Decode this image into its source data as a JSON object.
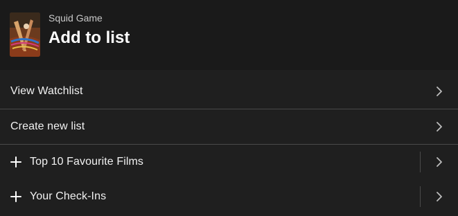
{
  "header": {
    "subtitle": "Squid Game",
    "title": "Add to list",
    "poster_icon": "poster-thumbnail"
  },
  "rows": [
    {
      "label": "View Watchlist",
      "icon": "chevron-right-icon"
    },
    {
      "label": "Create new list",
      "icon": "chevron-right-icon"
    },
    {
      "label": "Top 10 Favourite Films",
      "icon": "plus-icon"
    },
    {
      "label": "Your Check-Ins",
      "icon": "plus-icon"
    }
  ],
  "colors": {
    "background": "#1f1f1f",
    "header_background": "#1a1a1a",
    "divider": "#4a4a4a",
    "text": "#f2f2f2"
  }
}
